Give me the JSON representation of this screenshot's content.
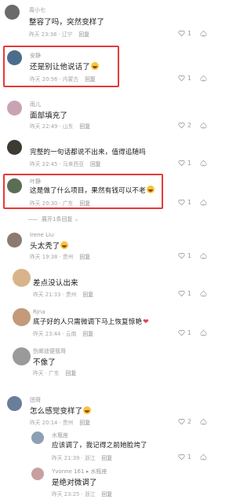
{
  "comments": [
    {
      "name": "周小七",
      "text": "整容了吗，突然变样了",
      "time": "昨天 23:38 · 辽宁",
      "reply": "回复",
      "likes": "1",
      "avatar_color": "#6b6b6b"
    },
    {
      "name": "安静",
      "text": "还是别让他说话了",
      "time": "昨天 20:56 · 内蒙古",
      "reply": "回复",
      "likes": "1",
      "avatar_color": "#4a6d8c"
    },
    {
      "name": "雨儿",
      "text": "面部填充了",
      "time": "昨天 22:49 · 山东",
      "reply": "回复",
      "likes": "2",
      "avatar_color": "#c9a3b3"
    },
    {
      "name": "",
      "text": "完整的一句话都说不出来，值得追随吗",
      "time": "昨天 22:45 · 马来西亚",
      "reply": "回复",
      "likes": "1",
      "avatar_color": "#3d3a33"
    },
    {
      "name": "叶静",
      "text": "这是做了什么项目，果然有钱可以不老",
      "time": "昨天 20:30 · 广东",
      "reply": "回复",
      "likes": "1",
      "avatar_color": "#5b6e55"
    },
    {
      "name": "Irene Liu",
      "text": "头太秃了",
      "time": "昨天 19:38 · 贵州",
      "reply": "回复",
      "likes": "1",
      "avatar_color": "#8d7a6e"
    },
    {
      "name": "",
      "text": "差点没认出来",
      "time": "昨天 21:33 · 贵州",
      "reply": "回复",
      "likes": "1",
      "avatar_color": "#d9b48a"
    },
    {
      "name": "",
      "text": "底子好的人只需微调下马上恢复惊艳",
      "time": "昨天 23:44 · 云南",
      "reply": "回复",
      "likes": "1",
      "avatar_color": "#c49a7a"
    },
    {
      "name": "Rjna",
      "text": "",
      "time": "",
      "reply": "",
      "likes": "",
      "avatar_color": "#7a5a48"
    },
    {
      "name": "伤邮遥便我哥",
      "text": "不像了",
      "time": "昨天 · 广东",
      "reply": "回复",
      "likes": "",
      "avatar_color": "#9a9a9a"
    },
    {
      "name": "团哥",
      "text": "怎么感觉变样了",
      "time": "昨天 20:14 · 贵州",
      "reply": "回复",
      "likes": "2",
      "avatar_color": "#6a7d9a"
    }
  ],
  "expand_label": "展开1条回复",
  "replies": [
    {
      "name": "水瓶座",
      "text": "应该调了，我记得之前她脸垮了",
      "time": "昨天 21:39 · 浙江",
      "reply": "回复",
      "likes": "1",
      "avatar_color": "#8da0b3"
    },
    {
      "name": "Yvonne 161",
      "reply_to": "水瓶座",
      "text": "是绝对微调了",
      "time": "昨天 23:25 · 浙江",
      "reply": "回复",
      "likes": "",
      "avatar_color": "#c8a0a0"
    }
  ],
  "colors": {
    "highlight": "#e53a3a",
    "text": "#1a1a1a",
    "meta": "#a5a5a5"
  }
}
